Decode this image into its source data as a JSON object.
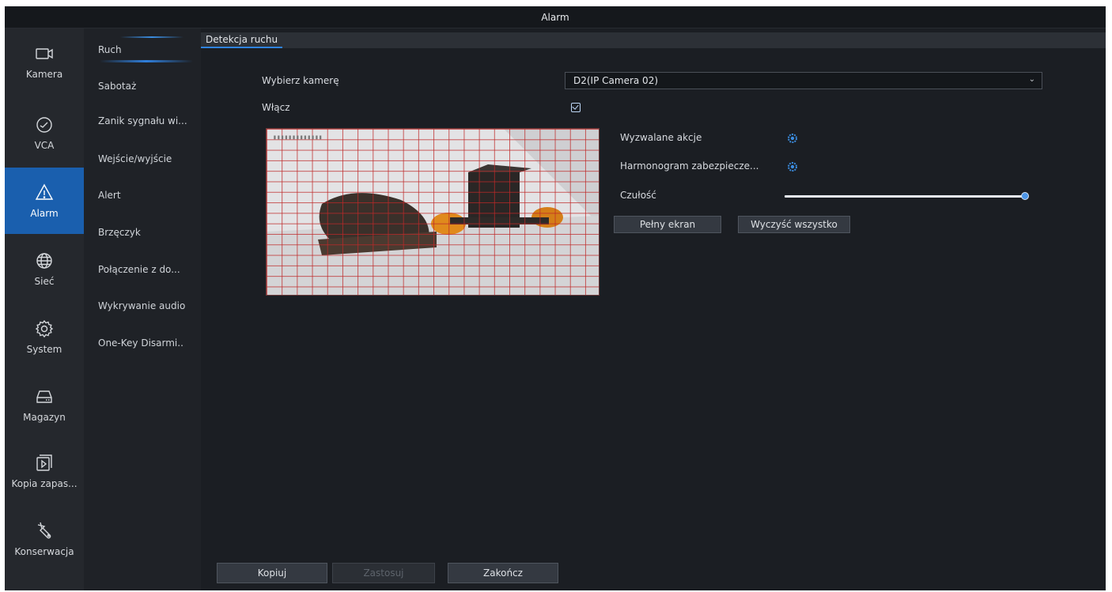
{
  "window": {
    "title": "Alarm"
  },
  "rail": {
    "items": [
      {
        "label": "Kamera",
        "icon": "camera-icon"
      },
      {
        "label": "VCA",
        "icon": "vca-icon"
      },
      {
        "label": "Alarm",
        "icon": "alarm-icon",
        "active": true
      },
      {
        "label": "Sieć",
        "icon": "globe-icon"
      },
      {
        "label": "System",
        "icon": "gear-icon"
      },
      {
        "label": "Magazyn",
        "icon": "storage-icon"
      },
      {
        "label": "Kopia zapas...",
        "icon": "backup-icon"
      },
      {
        "label": "Konserwacja",
        "icon": "wrench-icon"
      }
    ],
    "active_color": "#1a5fae"
  },
  "submenu": {
    "items": [
      {
        "label": "Ruch",
        "active": true
      },
      {
        "label": "Sabotaż"
      },
      {
        "label": "Zanik sygnału wi..."
      },
      {
        "label": "Wejście/wyjście"
      },
      {
        "label": "Alert"
      },
      {
        "label": "Brzęczyk"
      },
      {
        "label": "Połączenie z do..."
      },
      {
        "label": "Wykrywanie audio"
      },
      {
        "label": "One-Key Disarmi.."
      }
    ]
  },
  "tabs": [
    {
      "label": "Detekcja ruchu",
      "active": true
    }
  ],
  "form": {
    "camera_label": "Wybierz kamerę",
    "camera_value": "D2(IP Camera 02)",
    "enable_label": "Włącz",
    "enable_checked": true,
    "triggered_actions_label": "Wyzwalane akcje",
    "schedule_label": "Harmonogram zabezpiecze...",
    "sensitivity_label": "Czułość",
    "sensitivity_fraction": 1.0,
    "fullscreen_button": "Pełny ekran",
    "clear_all_button": "Wyczyść wszystko"
  },
  "footer": {
    "copy_button": "Kopiuj",
    "apply_button": "Zastosuj",
    "exit_button": "Zakończ"
  },
  "colors": {
    "accent": "#2f83de",
    "grid_red": "#be2828",
    "gear_blue": "#3b8de0"
  }
}
